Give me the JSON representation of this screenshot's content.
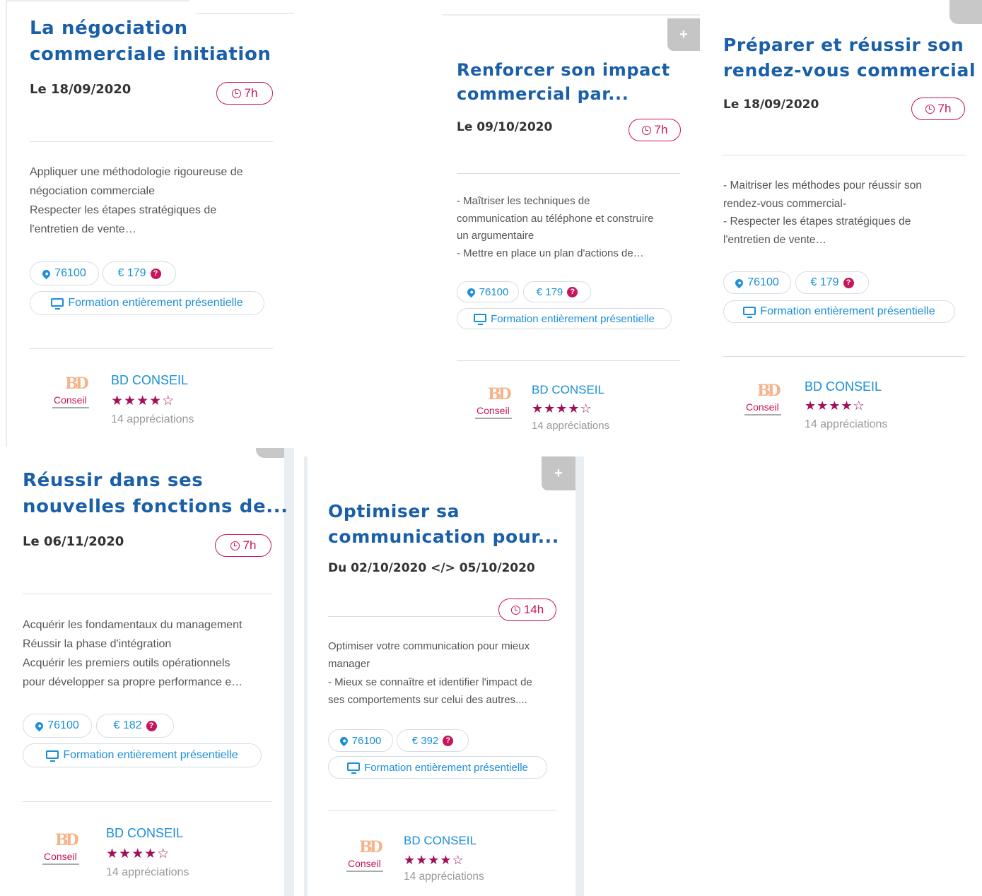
{
  "cards": [
    {
      "title": [
        "La négociation",
        "commerciale initiation"
      ],
      "date": "Le 18/09/2020",
      "duration": "7h",
      "description": [
        "Appliquer une méthodologie rigoureuse de",
        "négociation commerciale",
        "Respecter les étapes stratégiques de",
        "l'entretien de vente…"
      ],
      "postcode": "76100",
      "price": "€ 179",
      "mode": "Formation entièrement présentielle",
      "company": "BD CONSEIL",
      "stars": "★★★★☆",
      "reviews": "14 appréciations",
      "logo_text": "Conseil",
      "has_plus": false
    },
    {
      "title": [
        "Renforcer son impact",
        "commercial par..."
      ],
      "date": "Le 09/10/2020",
      "duration": "7h",
      "description": [
        "- Maîtriser les techniques de",
        "communication au téléphone et construire",
        "un argumentaire",
        "- Mettre en place un plan d'actions de…"
      ],
      "postcode": "76100",
      "price": "€ 179",
      "mode": "Formation entièrement présentielle",
      "company": "BD CONSEIL",
      "stars": "★★★★☆",
      "reviews": "14 appréciations",
      "logo_text": "Conseil",
      "has_plus": true,
      "plus_label": "+"
    },
    {
      "title": [
        "Préparer et réussir son",
        "rendez-vous commercial"
      ],
      "date": "Le 18/09/2020",
      "duration": "7h",
      "description": [
        "- Maitriser les méthodes pour réussir son",
        "rendez-vous commercial-",
        "- Respecter les étapes stratégiques de",
        "l'entretien de vente…"
      ],
      "postcode": "76100",
      "price": "€ 179",
      "mode": "Formation entièrement présentielle",
      "company": "BD CONSEIL",
      "stars": "★★★★☆",
      "reviews": "14 appréciations",
      "logo_text": "Conseil",
      "has_plus": false
    },
    {
      "title": [
        "Réussir dans ses",
        "nouvelles fonctions de..."
      ],
      "date": "Le 06/11/2020",
      "duration": "7h",
      "description": [
        "Acquérir les fondamentaux du management",
        "Réussir la phase d'intégration",
        "Acquérir les premiers outils opérationnels",
        "pour développer sa propre performance e…"
      ],
      "postcode": "76100",
      "price": "€ 182",
      "mode": "Formation entièrement présentielle",
      "company": "BD CONSEIL",
      "stars": "★★★★☆",
      "reviews": "14 appréciations",
      "logo_text": "Conseil",
      "has_plus": false
    },
    {
      "title": [
        "Optimiser sa",
        "communication pour..."
      ],
      "date": "Du 02/10/2020 </> 05/10/2020",
      "duration": "14h",
      "description": [
        "Optimiser votre communication pour mieux",
        "manager",
        "- Mieux se connaître et identifier l'impact de",
        "ses comportements sur celui des autres...."
      ],
      "postcode": "76100",
      "price": "€ 392",
      "mode": "Formation entièrement présentielle",
      "company": "BD CONSEIL",
      "stars": "★★★★☆",
      "reviews": "14 appréciations",
      "logo_text": "Conseil",
      "has_plus": true,
      "plus_label": "+"
    }
  ]
}
